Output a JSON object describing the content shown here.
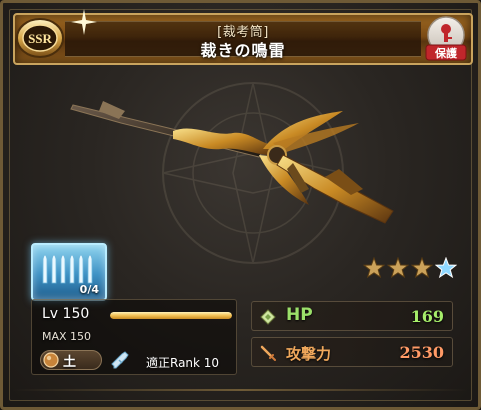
{
  "card": {
    "rarity": "SSR",
    "weapon_type": "[裁考筒]",
    "name": "裁きの鳴雷",
    "lock_label": "保護"
  },
  "skill_slot": {
    "count": "0/4"
  },
  "uncap_stars": {
    "total": 4,
    "filled": 3,
    "special": 1
  },
  "level": {
    "label": "Lv 150",
    "max": "MAX 150",
    "progress": 1.0
  },
  "element": {
    "label": "土",
    "icon": "earth-orb-icon"
  },
  "rank": {
    "label": "適正Rank 10"
  },
  "stats": {
    "hp": {
      "label": "HP",
      "value": "169",
      "icon": "diamond-icon"
    },
    "atk": {
      "label": "攻撃力",
      "value": "2530",
      "icon": "sword-icon"
    }
  },
  "colors": {
    "accent_gold": "#c9a45e",
    "hp_green": "#9be06a",
    "atk_orange": "#ff9a66",
    "slot_blue": "#3e91c4"
  }
}
